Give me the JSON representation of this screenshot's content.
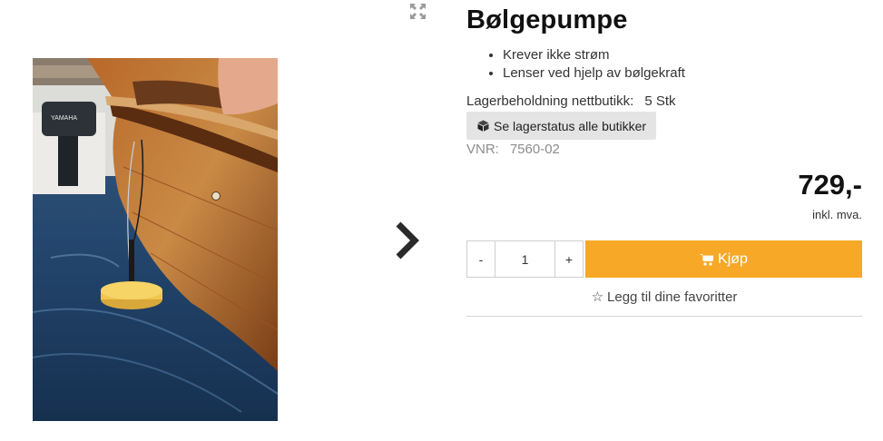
{
  "product": {
    "title": "Bølgepumpe",
    "bullets": [
      "Krever ikke strøm",
      "Lenser ved hjelp av bølgekraft"
    ],
    "stock_label": "Lagerbeholdning nettbutikk:",
    "stock_value": "5 Stk",
    "store_status_button": "Se lagerstatus alle butikker",
    "vnr_label": "VNR:",
    "vnr_value": "7560-02",
    "price": "729,-",
    "vat_note": "inkl. mva.",
    "quantity": "1",
    "qty_minus": "-",
    "qty_plus": "+",
    "buy_label": "Kjøp",
    "favorite_label": "Legg til dine favoritter",
    "image_outboard_brand": "YAMAHA"
  },
  "colors": {
    "buy_button": "#f7a827",
    "store_button_bg": "#e4e4e4",
    "muted_text": "#8d8d8d"
  },
  "icons": [
    "expand-icon",
    "chevron-right-icon",
    "box-icon",
    "cart-icon",
    "star-outline-icon"
  ]
}
